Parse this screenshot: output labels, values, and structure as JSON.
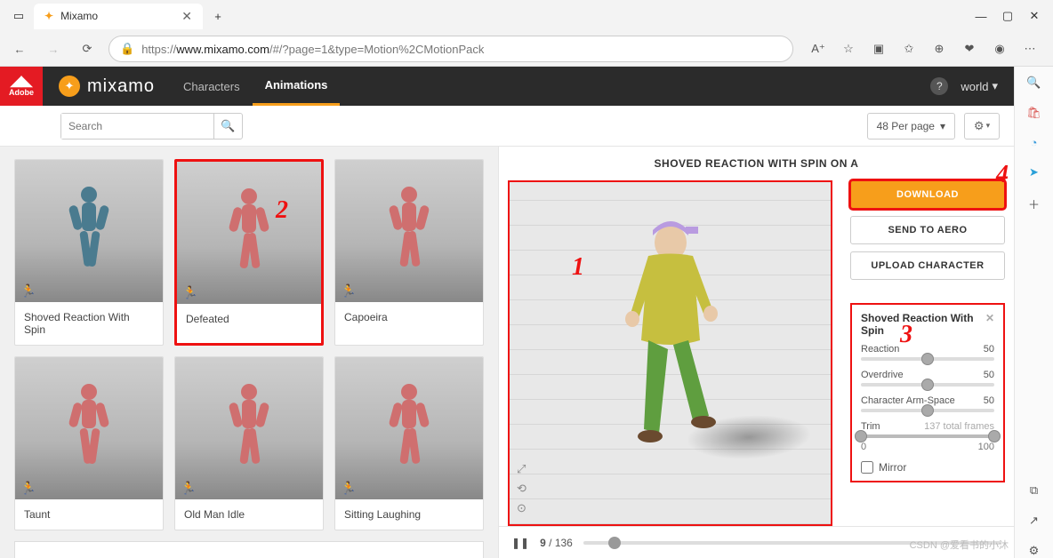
{
  "browser": {
    "tab_title": "Mixamo",
    "url_protocol": "https://",
    "url_host": "www.mixamo.com",
    "url_path": "/#/?page=1&type=Motion%2CMotionPack",
    "window_min": "—",
    "window_max": "▢",
    "window_close": "✕",
    "new_tab": "+"
  },
  "nav": {
    "brand": "mixamo",
    "adobe": "Adobe",
    "characters": "Characters",
    "animations": "Animations",
    "world": "world"
  },
  "filter": {
    "search_placeholder": "Search",
    "per_page": "48 Per page"
  },
  "cards": [
    {
      "label": "Shoved Reaction With Spin",
      "selected": false,
      "color": "#4a7b8f"
    },
    {
      "label": "Defeated",
      "selected": true,
      "color": "#cf6f6f"
    },
    {
      "label": "Capoeira",
      "selected": false,
      "color": "#cf6f6f"
    },
    {
      "label": "Taunt",
      "selected": false,
      "color": "#cf6f6f"
    },
    {
      "label": "Old Man Idle",
      "selected": false,
      "color": "#cf6f6f"
    },
    {
      "label": "Sitting Laughing",
      "selected": false,
      "color": "#cf6f6f"
    }
  ],
  "preview": {
    "title": "SHOVED REACTION WITH SPIN ON A",
    "download": "DOWNLOAD",
    "send_aero": "SEND TO AERO",
    "upload": "UPLOAD CHARACTER",
    "panel_title": "Shoved Reaction With Spin",
    "sliders": {
      "reaction": {
        "label": "Reaction",
        "value": 50
      },
      "overdrive": {
        "label": "Overdrive",
        "value": 50
      },
      "arm_space": {
        "label": "Character Arm-Space",
        "value": 50
      },
      "trim": {
        "label": "Trim",
        "frames": "137 total frames",
        "min": 0,
        "max": 100
      }
    },
    "mirror": "Mirror",
    "frame_current": 9,
    "frame_total": 136
  },
  "annotations": {
    "a1": "1",
    "a2": "2",
    "a3": "3",
    "a4": "4"
  },
  "watermark": "CSDN @爱看书的小沐"
}
